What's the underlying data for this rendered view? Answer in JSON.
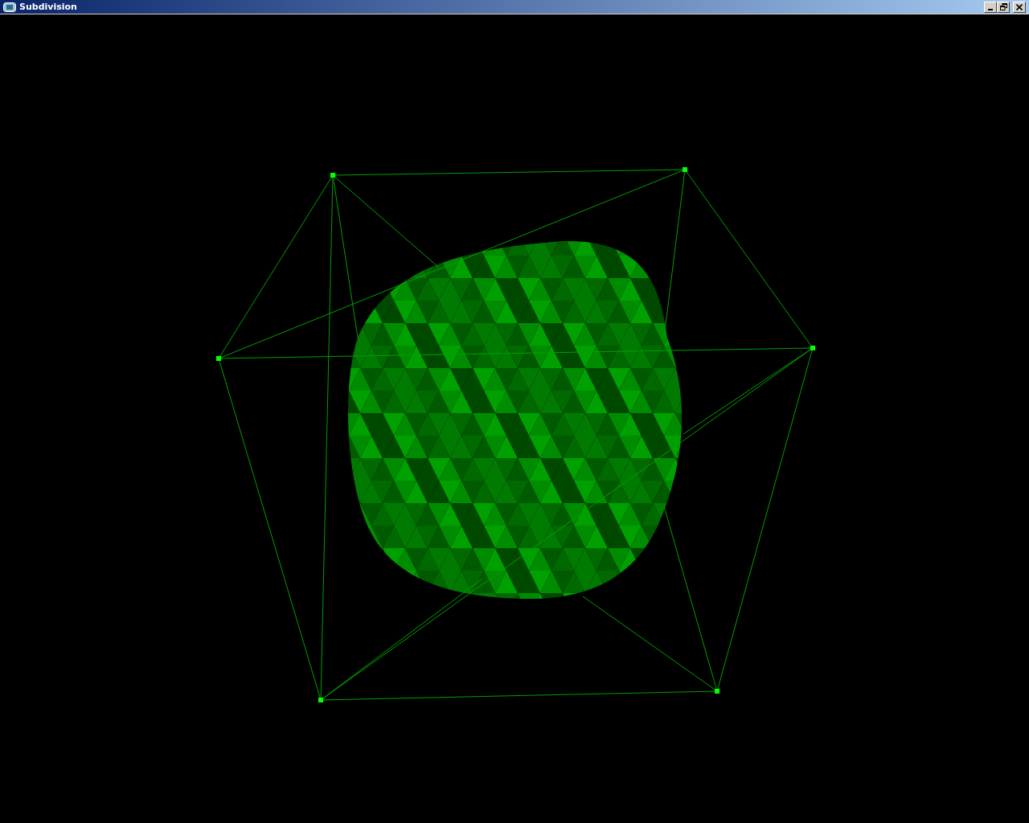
{
  "window": {
    "title": "Subdivision"
  }
}
